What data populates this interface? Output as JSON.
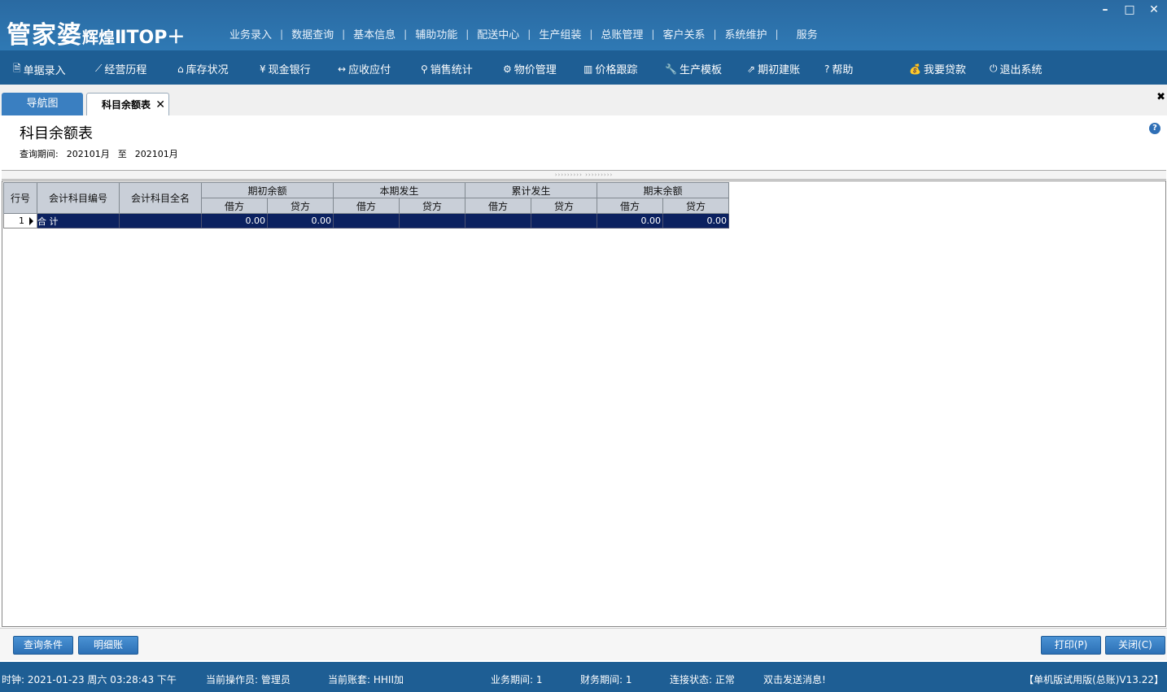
{
  "app": {
    "logo_main": "管家婆",
    "logo_sub": "辉煌",
    "logo_edition": "ⅡTOP＋"
  },
  "top_menu": [
    "业务录入",
    "数据查询",
    "基本信息",
    "辅助功能",
    "配送中心",
    "生产组装",
    "总账管理",
    "客户关系",
    "系统维护",
    "服务"
  ],
  "toolbar": [
    {
      "label": "单据录入",
      "icon": "document-icon"
    },
    {
      "label": "经营历程",
      "icon": "chart-line-icon"
    },
    {
      "label": "库存状况",
      "icon": "home-icon"
    },
    {
      "label": "现金银行",
      "icon": "yen-icon"
    },
    {
      "label": "应收应付",
      "icon": "exchange-icon"
    },
    {
      "label": "销售统计",
      "icon": "search-icon"
    },
    {
      "label": "物价管理",
      "icon": "gear-icon"
    },
    {
      "label": "价格跟踪",
      "icon": "bar-chart-icon"
    },
    {
      "label": "生产模板",
      "icon": "wrench-icon"
    },
    {
      "label": "期初建账",
      "icon": "external-link-icon"
    },
    {
      "label": "帮助",
      "icon": "question-icon"
    },
    {
      "label": "我要贷款",
      "icon": "money-bag-icon"
    },
    {
      "label": "退出系统",
      "icon": "power-icon"
    }
  ],
  "tabs": {
    "nav": "导航图",
    "active": "科目余额表"
  },
  "report": {
    "title": "科目余额表",
    "period_label": "查询期间:",
    "period_from": "202101月",
    "period_to_word": "至",
    "period_to": "202101月"
  },
  "grid": {
    "headers": {
      "rowno": "行号",
      "code": "会计科目编号",
      "name": "会计科目全名",
      "group1": "期初余额",
      "group2": "本期发生",
      "group3": "累计发生",
      "group4": "期末余额",
      "debit": "借方",
      "credit": "贷方"
    },
    "rows": [
      {
        "rowno": "1",
        "code": "合  计",
        "name": "",
        "open_debit": "0.00",
        "open_credit": "0.00",
        "cur_debit": "",
        "cur_credit": "",
        "acc_debit": "",
        "acc_credit": "",
        "end_debit": "0.00",
        "end_credit": "0.00"
      }
    ]
  },
  "buttons": {
    "query": "查询条件",
    "detail": "明细账",
    "print": "打印(P)",
    "close": "关闭(C)"
  },
  "status": {
    "clock": "时钟: 2021-01-23 周六 03:28:43 下午",
    "operator": "当前操作员: 管理员",
    "account": "当前账套: HHII加",
    "biz_period": "业务期间: 1",
    "fin_period": "财务期间: 1",
    "connection": "连接状态: 正常",
    "message": "双击发送消息!",
    "version": "【单机版试用版(总账)V13.22】"
  }
}
